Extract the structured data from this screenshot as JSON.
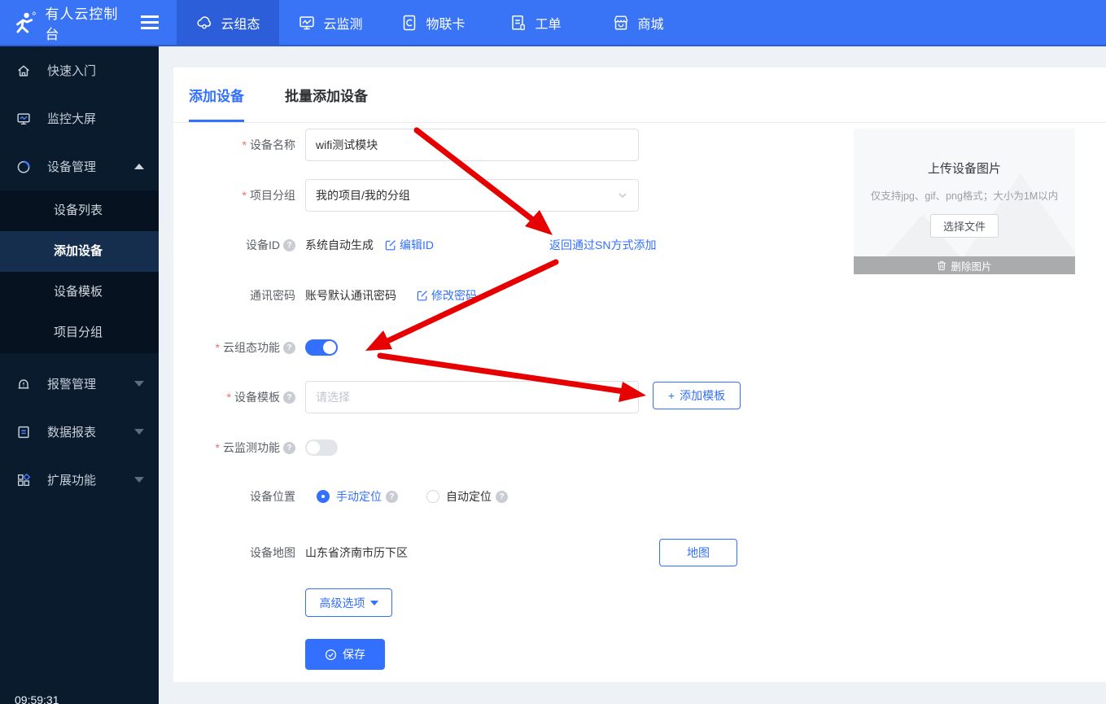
{
  "topbar": {
    "brand": "有人云控制台",
    "nav": [
      {
        "label": "云组态",
        "active": true
      },
      {
        "label": "云监测",
        "active": false
      },
      {
        "label": "物联卡",
        "active": false
      },
      {
        "label": "工单",
        "active": false
      },
      {
        "label": "商城",
        "active": false
      }
    ]
  },
  "sidebar": {
    "items": [
      {
        "label": "快速入门"
      },
      {
        "label": "监控大屏"
      },
      {
        "label": "设备管理"
      }
    ],
    "device_submenu": [
      {
        "label": "设备列表",
        "active": false
      },
      {
        "label": "添加设备",
        "active": true
      },
      {
        "label": "设备模板",
        "active": false
      },
      {
        "label": "项目分组",
        "active": false
      }
    ],
    "items_bottom": [
      {
        "label": "报警管理"
      },
      {
        "label": "数据报表"
      },
      {
        "label": "扩展功能"
      }
    ],
    "clock": "09:59:31"
  },
  "tabs": [
    {
      "label": "添加设备",
      "active": true
    },
    {
      "label": "批量添加设备",
      "active": false
    }
  ],
  "form": {
    "required_mark": "*",
    "help_mark": "?",
    "device_name": {
      "label": "设备名称",
      "value": "wifi测试模块"
    },
    "project_group": {
      "label": "项目分组",
      "value": "我的项目/我的分组"
    },
    "device_id": {
      "label": "设备ID",
      "value": "系统自动生成",
      "edit_link": "编辑ID",
      "sn_link": "返回通过SN方式添加"
    },
    "comm_password": {
      "label": "通讯密码",
      "value": "账号默认通讯密码",
      "edit_link": "修改密码"
    },
    "scada_switch": {
      "label": "云组态功能",
      "state": "on"
    },
    "device_template": {
      "label": "设备模板",
      "placeholder": "请选择",
      "add_plus": "+",
      "add_label": "添加模板"
    },
    "monitor_switch": {
      "label": "云监测功能",
      "state": "off"
    },
    "device_location": {
      "label": "设备位置",
      "options": [
        {
          "label": "手动定位",
          "selected": true
        },
        {
          "label": "自动定位",
          "selected": false
        }
      ]
    },
    "device_map": {
      "label": "设备地图",
      "value": "山东省济南市历下区",
      "map_button": "地图"
    },
    "advanced_button": "高级选项",
    "save_button": "保存"
  },
  "upload": {
    "title": "上传设备图片",
    "hint": "仅支持jpg、gif、png格式；大小为1M以内",
    "choose_button": "选择文件",
    "delete_button": "删除图片"
  },
  "colors": {
    "topbar": "#3a74f6",
    "topbar_active": "#2b5ed8",
    "sidebar": "#0a1b2e",
    "sidebar_active": "#152e4e",
    "accent": "#3370ff",
    "annotation_red": "#e60000"
  }
}
